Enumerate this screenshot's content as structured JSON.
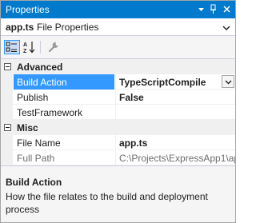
{
  "window": {
    "title": "Properties"
  },
  "object_selector": {
    "name": "app.ts",
    "type": "File Properties"
  },
  "toolbar": {
    "categorized_icon": "categorized-icon",
    "alphabetical_icon": "alphabetical-icon",
    "property_pages_icon": "wrench-icon"
  },
  "grid": {
    "categories": [
      {
        "label": "Advanced",
        "properties": [
          {
            "name": "Build Action",
            "value": "TypeScriptCompile",
            "selected": true,
            "bold": true
          },
          {
            "name": "Publish",
            "value": "False",
            "bold": true
          },
          {
            "name": "TestFramework",
            "value": ""
          }
        ]
      },
      {
        "label": "Misc",
        "properties": [
          {
            "name": "File Name",
            "value": "app.ts",
            "bold": true
          },
          {
            "name": "Full Path",
            "value": "C:\\Projects\\ExpressApp1\\app.ts",
            "readonly": true
          }
        ]
      }
    ]
  },
  "description": {
    "title": "Build Action",
    "text": "How the file relates to the build and deployment process"
  },
  "colors": {
    "accent": "#007acc",
    "selection": "#3399ff"
  }
}
